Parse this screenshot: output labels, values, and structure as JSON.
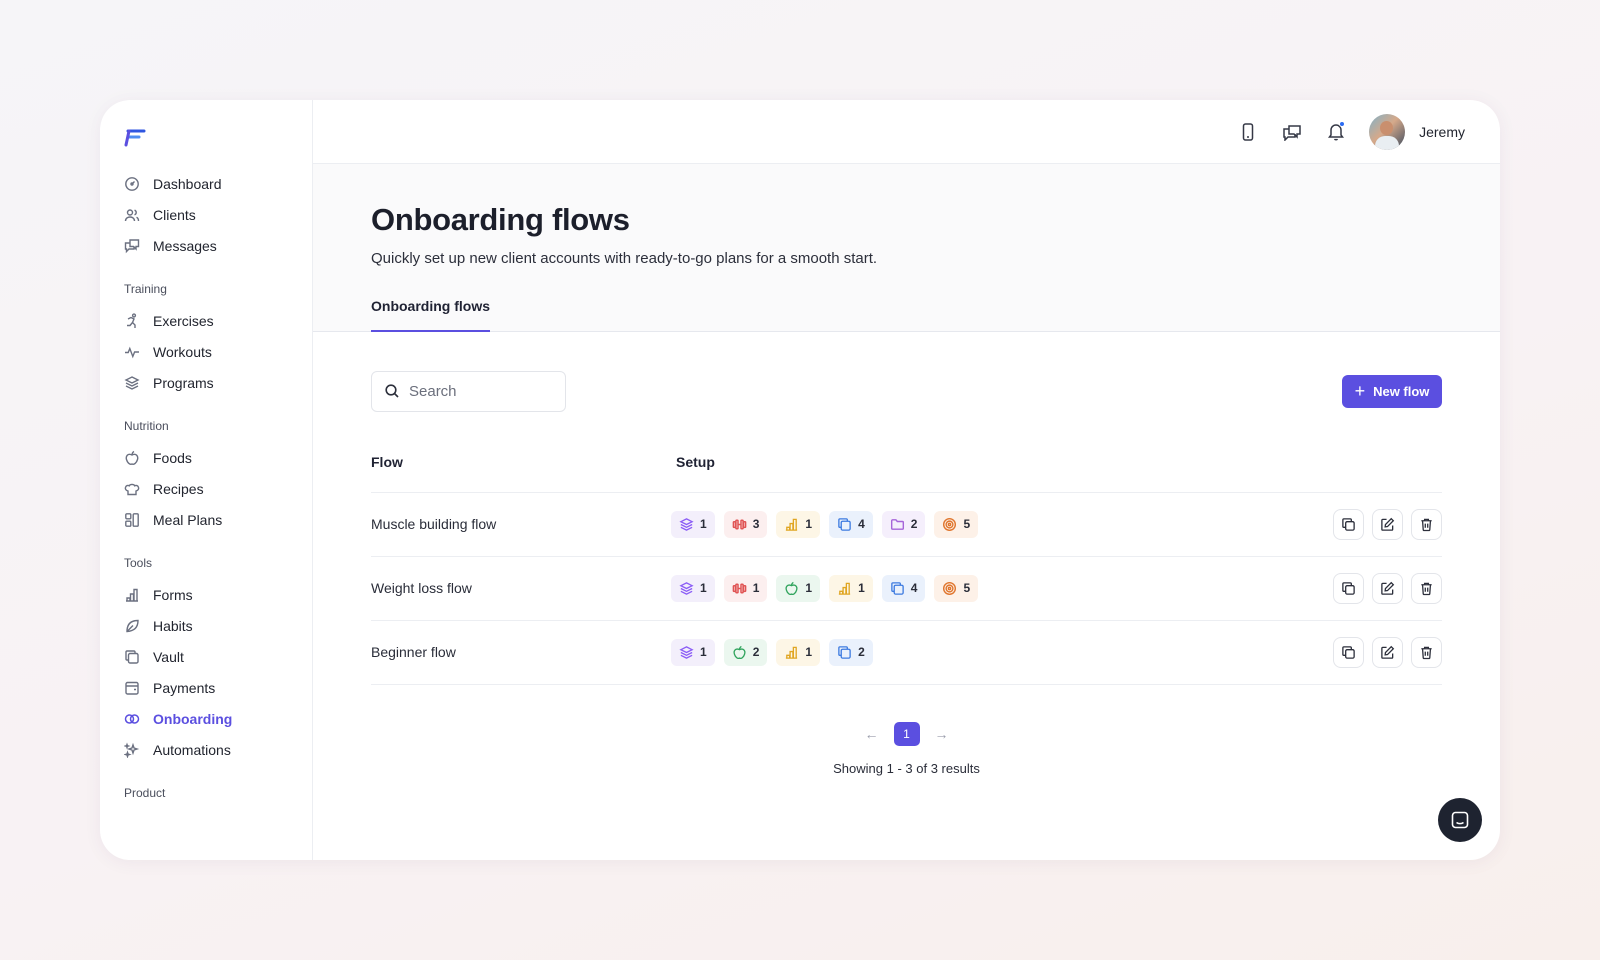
{
  "user": {
    "name": "Jeremy"
  },
  "nav": {
    "main": [
      {
        "label": "Dashboard",
        "icon": "dashboard-icon"
      },
      {
        "label": "Clients",
        "icon": "users-icon"
      },
      {
        "label": "Messages",
        "icon": "messages-icon"
      }
    ],
    "sections": [
      {
        "label": "Training",
        "items": [
          "Exercises",
          "Workouts",
          "Programs"
        ]
      },
      {
        "label": "Nutrition",
        "items": [
          "Foods",
          "Recipes",
          "Meal Plans"
        ]
      },
      {
        "label": "Tools",
        "items": [
          "Forms",
          "Habits",
          "Vault",
          "Payments",
          "Onboarding",
          "Automations"
        ]
      },
      {
        "label": "Product",
        "items": []
      }
    ],
    "active": "Onboarding"
  },
  "header": {
    "title": "Onboarding flows",
    "subtitle": "Quickly set up new client accounts with ready-to-go plans for a smooth start.",
    "tab": "Onboarding flows"
  },
  "search": {
    "placeholder": "Search",
    "value": ""
  },
  "new_button": {
    "label": "New flow"
  },
  "table": {
    "columns": [
      "Flow",
      "Setup"
    ],
    "rows": [
      {
        "name": "Muscle building flow",
        "chips": [
          {
            "type": "programs",
            "count": "1"
          },
          {
            "type": "workouts",
            "count": "3"
          },
          {
            "type": "forms",
            "count": "1"
          },
          {
            "type": "vault",
            "count": "4"
          },
          {
            "type": "folder",
            "count": "2"
          },
          {
            "type": "goals",
            "count": "5"
          }
        ]
      },
      {
        "name": "Weight loss flow",
        "chips": [
          {
            "type": "programs",
            "count": "1"
          },
          {
            "type": "workouts",
            "count": "1"
          },
          {
            "type": "nutrition",
            "count": "1"
          },
          {
            "type": "forms",
            "count": "1"
          },
          {
            "type": "vault",
            "count": "4"
          },
          {
            "type": "goals",
            "count": "5"
          }
        ]
      },
      {
        "name": "Beginner flow",
        "chips": [
          {
            "type": "programs",
            "count": "1"
          },
          {
            "type": "nutrition",
            "count": "2"
          },
          {
            "type": "forms",
            "count": "1"
          },
          {
            "type": "vault",
            "count": "2"
          }
        ]
      }
    ]
  },
  "pagination": {
    "current_page": "1",
    "summary": "Showing 1 - 3 of 3 results"
  },
  "colors": {
    "accent": "#5b4fe0",
    "notification_dot": "#2d6cf2"
  }
}
